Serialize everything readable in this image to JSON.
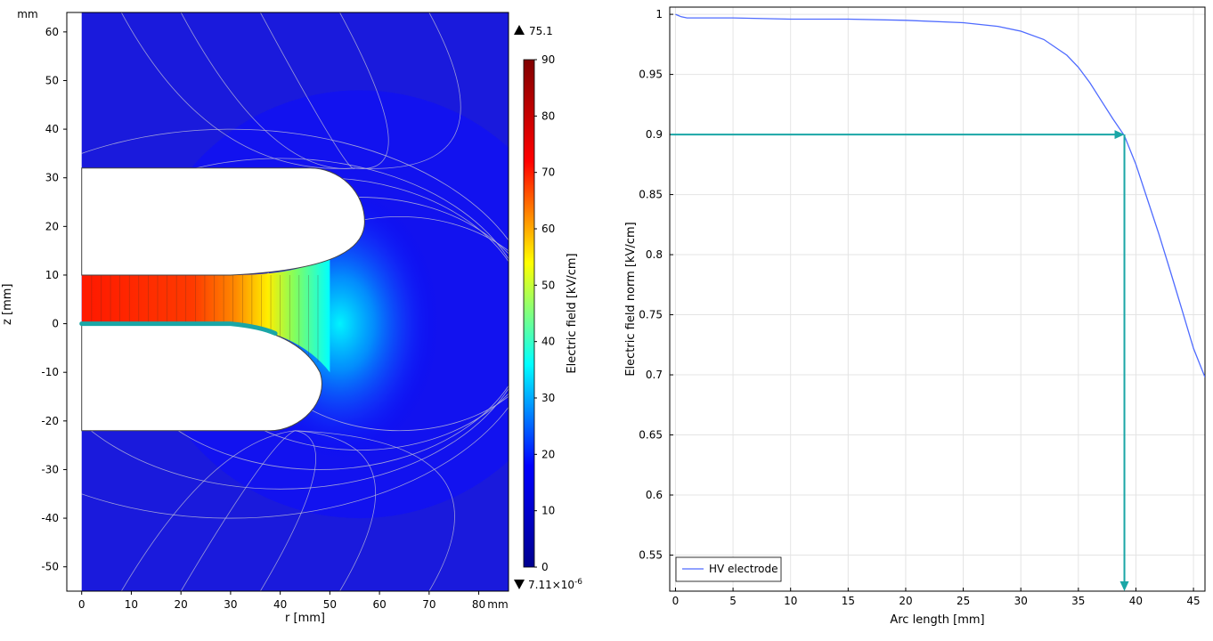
{
  "field_plot": {
    "type": "heatmap",
    "x_unit": "mm",
    "y_unit": "mm",
    "xlabel": "r [mm]",
    "ylabel": "z [mm]",
    "x_range": [
      -3,
      86
    ],
    "y_range": [
      -55,
      64
    ],
    "x_ticks": [
      0,
      10,
      20,
      30,
      40,
      50,
      60,
      70,
      80
    ],
    "y_ticks": [
      -50,
      -40,
      -30,
      -20,
      -10,
      0,
      10,
      20,
      30,
      40,
      50,
      60
    ],
    "colorbar": {
      "label": "Electric field [kV/cm]",
      "min": 0,
      "max": 90,
      "ticks": [
        0,
        10,
        20,
        30,
        40,
        50,
        60,
        70,
        80,
        90
      ],
      "max_marker": "75.1",
      "min_marker": "7.11×10",
      "min_marker_exp": "-6",
      "colormap": [
        "#00008f",
        "#0000ff",
        "#00ffff",
        "#ffff00",
        "#ff0000",
        "#800000"
      ]
    },
    "geometry": {
      "upper_electrode": {
        "z_bottom": 10,
        "z_top": 32,
        "r_tip": 57
      },
      "hv_electrode": {
        "z_top": 0,
        "z_bottom": -22,
        "r_tip": 48
      },
      "highlight_color": "#1aa6a6"
    }
  },
  "chart_data": {
    "type": "line",
    "xlabel": "Arc length [mm]",
    "ylabel": "Electric field norm [kV/cm]",
    "xlim": [
      -0.5,
      46
    ],
    "ylim": [
      0.52,
      1.0
    ],
    "x_ticks": [
      0,
      5,
      10,
      15,
      20,
      25,
      30,
      35,
      40,
      45
    ],
    "y_ticks": [
      0.55,
      0.6,
      0.65,
      0.7,
      0.75,
      0.8,
      0.85,
      0.9,
      0.95,
      1
    ],
    "legend_position": "bottom-left",
    "series": [
      {
        "name": "HV electrode",
        "color": "#4f6bff",
        "x": [
          0,
          0.5,
          1,
          3,
          5,
          10,
          15,
          20,
          25,
          28,
          30,
          32,
          34,
          35,
          36,
          37,
          38,
          39,
          40,
          41,
          42,
          43,
          44,
          45,
          46
        ],
        "y": [
          1.0,
          0.998,
          0.997,
          0.997,
          0.997,
          0.996,
          0.996,
          0.995,
          0.993,
          0.99,
          0.986,
          0.979,
          0.966,
          0.956,
          0.943,
          0.928,
          0.913,
          0.899,
          0.875,
          0.846,
          0.817,
          0.786,
          0.754,
          0.722,
          0.698
        ]
      }
    ],
    "annotation": {
      "color": "#1aa6a6",
      "y": 0.9,
      "x": 39.0,
      "x_end_label_side": "bottom"
    }
  }
}
